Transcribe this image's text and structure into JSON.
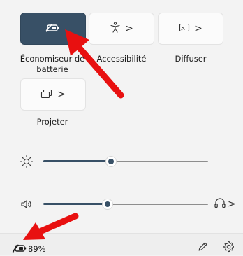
{
  "tiles": {
    "battery_saver": {
      "label": "Économiseur de batterie",
      "label_line1": "Économiseur de",
      "label_line2": "batterie",
      "icon": "battery-saver-icon",
      "active": true
    },
    "accessibility": {
      "label": "Accessibilité",
      "icon": "accessibility-icon",
      "chevron": ">"
    },
    "cast": {
      "label": "Diffuser",
      "icon": "cast-icon",
      "chevron": ">"
    },
    "project": {
      "label": "Projeter",
      "icon": "project-icon",
      "chevron": ">"
    }
  },
  "sliders": {
    "brightness": {
      "icon": "brightness-icon",
      "value_fraction": 0.41
    },
    "volume": {
      "icon": "volume-icon",
      "value_fraction": 0.39,
      "output_icon": "headphones-icon",
      "output_chevron": ">"
    }
  },
  "footer": {
    "battery_percent": "89%",
    "battery_icon": "battery-saver-icon",
    "edit_icon": "pencil-icon",
    "settings_icon": "gear-icon"
  },
  "annotations": {
    "arrow_color": "#e81010"
  },
  "colors": {
    "accent": "#385066",
    "panel_bg": "#f3f3f3"
  }
}
